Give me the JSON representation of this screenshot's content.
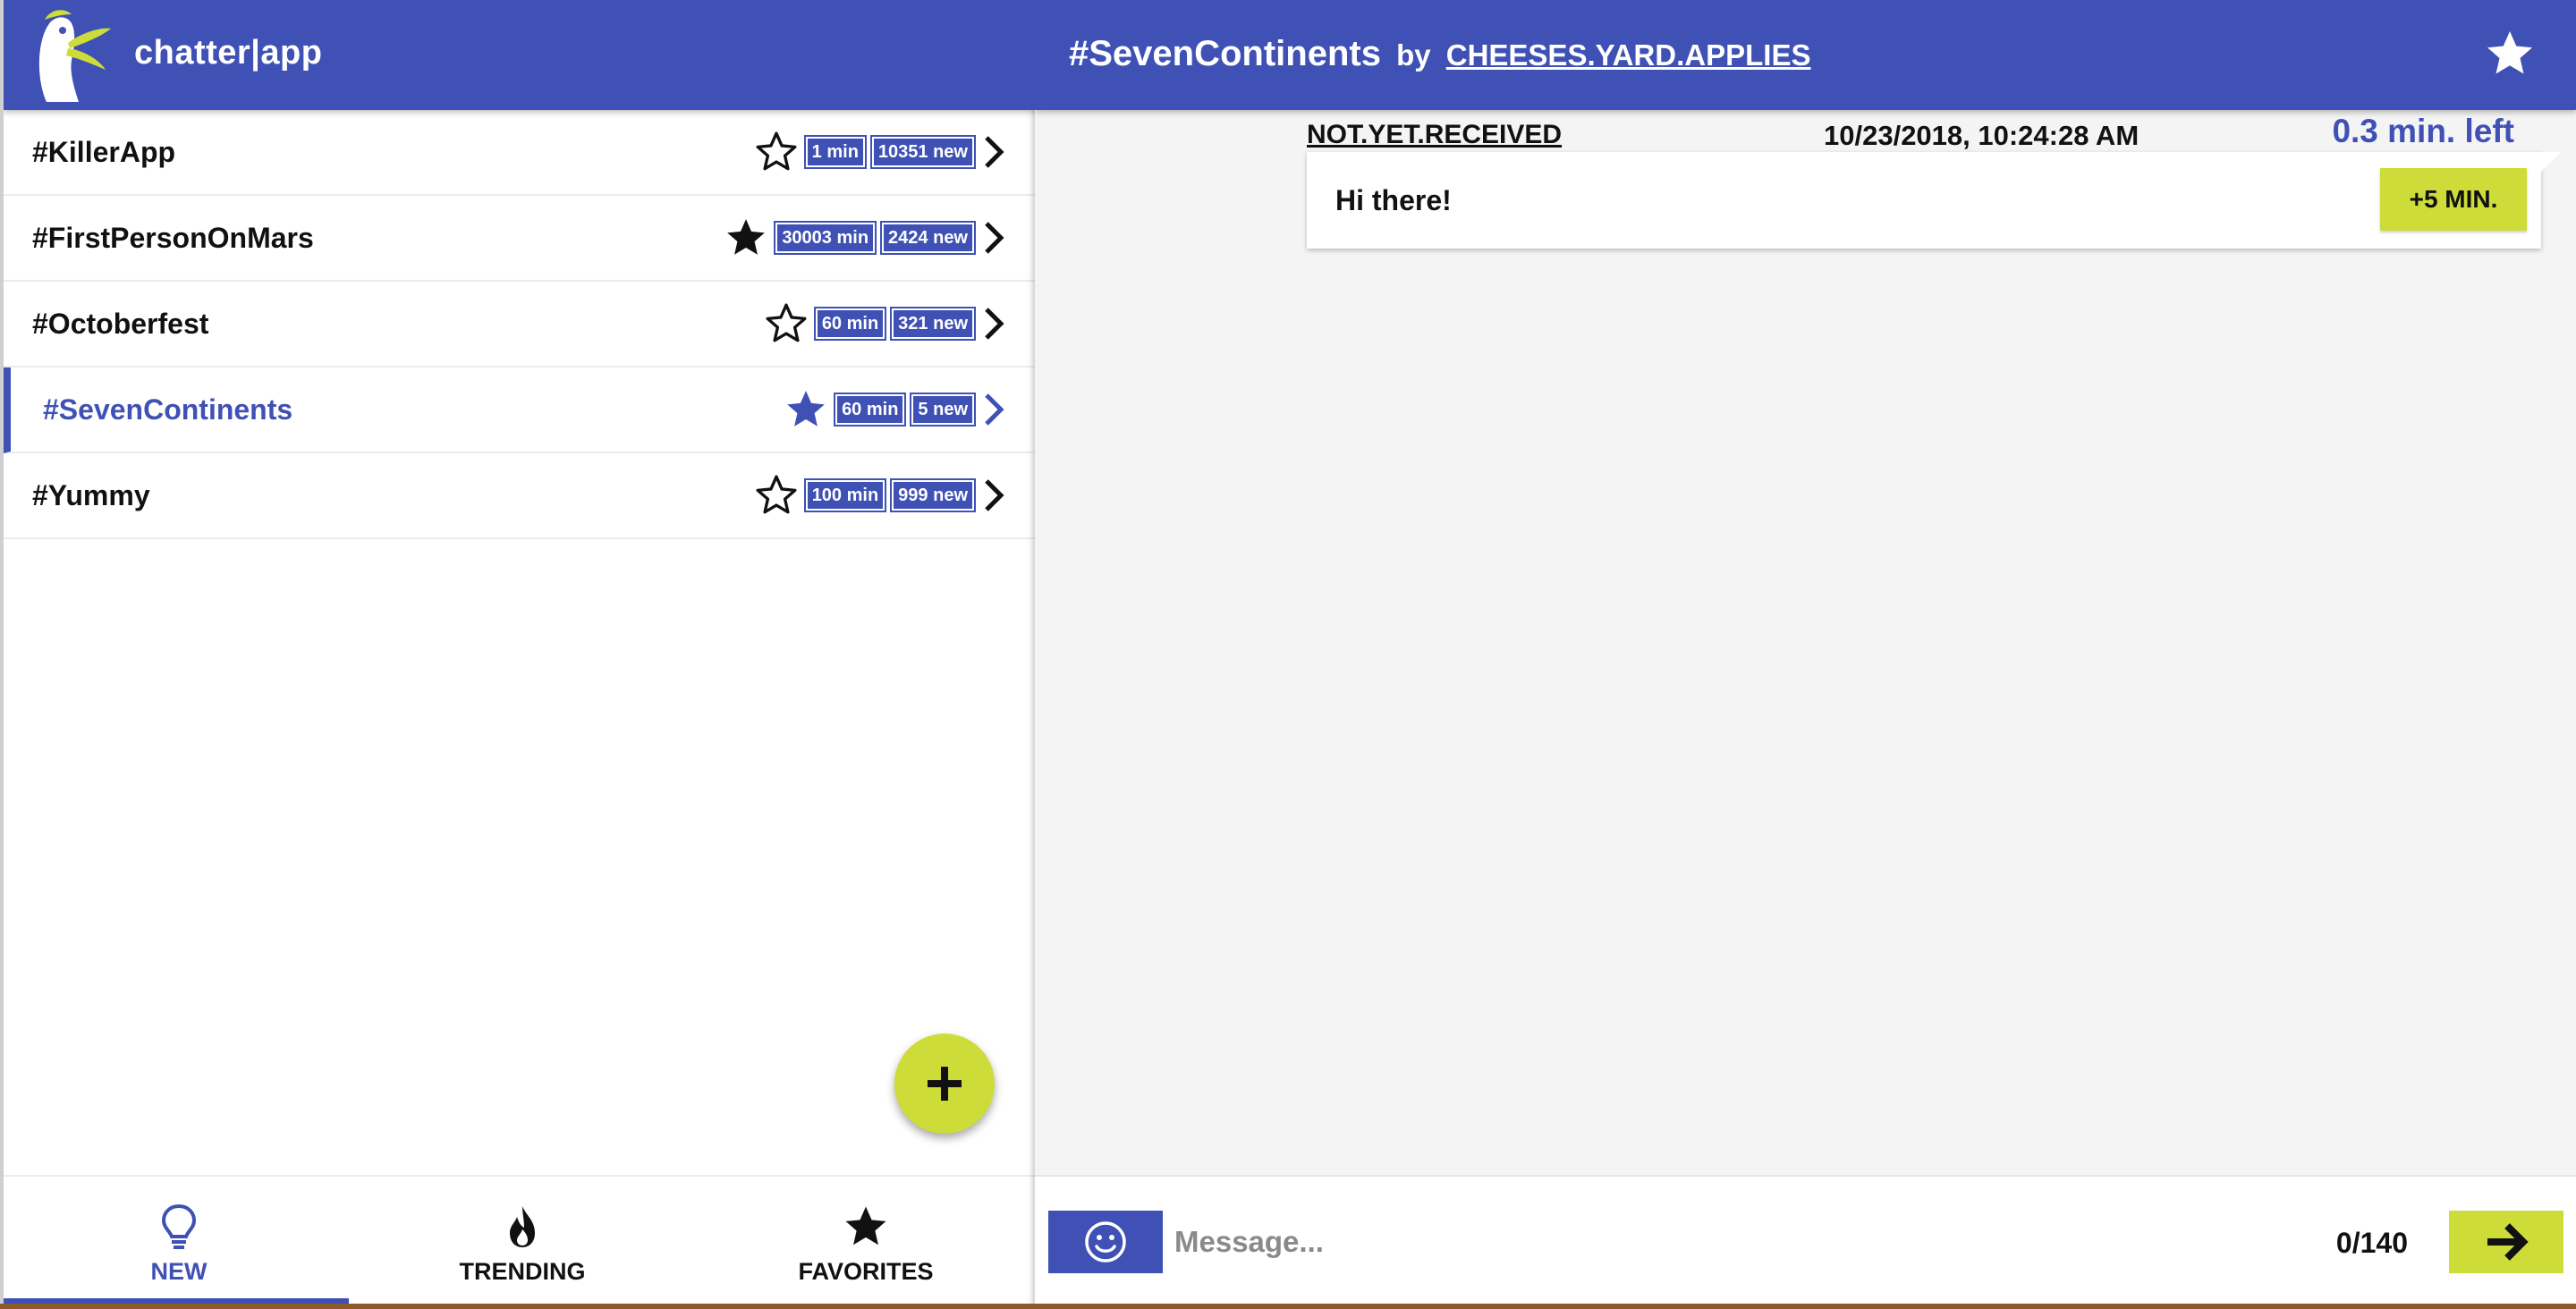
{
  "app": {
    "title": "chatter|app",
    "brand_color": "#3f51b5",
    "accent_color": "#cddc39"
  },
  "channels": [
    {
      "name": "#KillerApp",
      "favorite": false,
      "duration": "1 min",
      "new_count": "10351 new",
      "selected": false
    },
    {
      "name": "#FirstPersonOnMars",
      "favorite": true,
      "duration": "30003 min",
      "new_count": "2424 new",
      "selected": false
    },
    {
      "name": "#Octoberfest",
      "favorite": false,
      "duration": "60 min",
      "new_count": "321 new",
      "selected": false
    },
    {
      "name": "#SevenContinents",
      "favorite": true,
      "duration": "60 min",
      "new_count": "5 new",
      "selected": true
    },
    {
      "name": "#Yummy",
      "favorite": false,
      "duration": "100 min",
      "new_count": "999 new",
      "selected": false
    }
  ],
  "bottom_nav": {
    "tabs": [
      {
        "label": "NEW",
        "icon": "lightbulb-icon",
        "active": true
      },
      {
        "label": "TRENDING",
        "icon": "fire-icon",
        "active": false
      },
      {
        "label": "FAVORITES",
        "icon": "star-icon",
        "active": false
      }
    ]
  },
  "chat": {
    "channel": "#SevenContinents",
    "by": "by",
    "author": "CHEESES.YARD.APPLIES",
    "messages": [
      {
        "status": "NOT.YET.RECEIVED",
        "timestamp": "10/23/2018, 10:24:28 AM",
        "time_left": "0.3 min. left",
        "text": "Hi there!",
        "extend_label": "+5 MIN."
      }
    ]
  },
  "compose": {
    "placeholder": "Message...",
    "value": "",
    "char_count": "0/140"
  }
}
